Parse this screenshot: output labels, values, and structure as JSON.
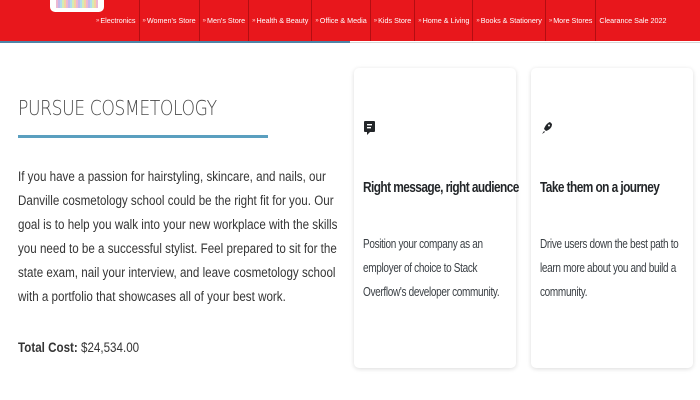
{
  "nav": {
    "items": [
      {
        "label": "Electronics",
        "bullet": true
      },
      {
        "label": "Women's Store",
        "bullet": true
      },
      {
        "label": "Men's Store",
        "bullet": true
      },
      {
        "label": "Health & Beauty",
        "bullet": true
      },
      {
        "label": "Office & Media",
        "bullet": true
      },
      {
        "label": "Kids Store",
        "bullet": true
      },
      {
        "label": "Home & Living",
        "bullet": true
      },
      {
        "label": "Books & Stationery",
        "bullet": true
      },
      {
        "label": "More Stores",
        "bullet": true
      },
      {
        "label": "Clearance Sale 2022",
        "bullet": false
      }
    ],
    "bullet_symbol": "»",
    "background_color": "#e8171c"
  },
  "program": {
    "title": "PURSUE COSMETOLOGY",
    "description": "If you have a passion for hairstyling, skincare, and nails, our Danville cosmetology school could be the right fit for you. Our goal is to help you walk into your new workplace with the skills you need to be a successful stylist. Feel prepared to sit for the state exam, nail your interview, and leave cosmetology school with a portfolio that showcases all of your best work.",
    "total_cost_label": "Total Cost:",
    "total_cost_value": "$24,534.00",
    "accent_color": "#5a9fbf"
  },
  "cards": [
    {
      "icon": "chat-bubble-icon",
      "title": "Right message, right audience",
      "text": "Position your company as an employer of choice to Stack Overflow's developer community."
    },
    {
      "icon": "rocket-icon",
      "title": "Take them on a journey",
      "text": "Drive users down the best path to learn more about you and build a community."
    }
  ]
}
